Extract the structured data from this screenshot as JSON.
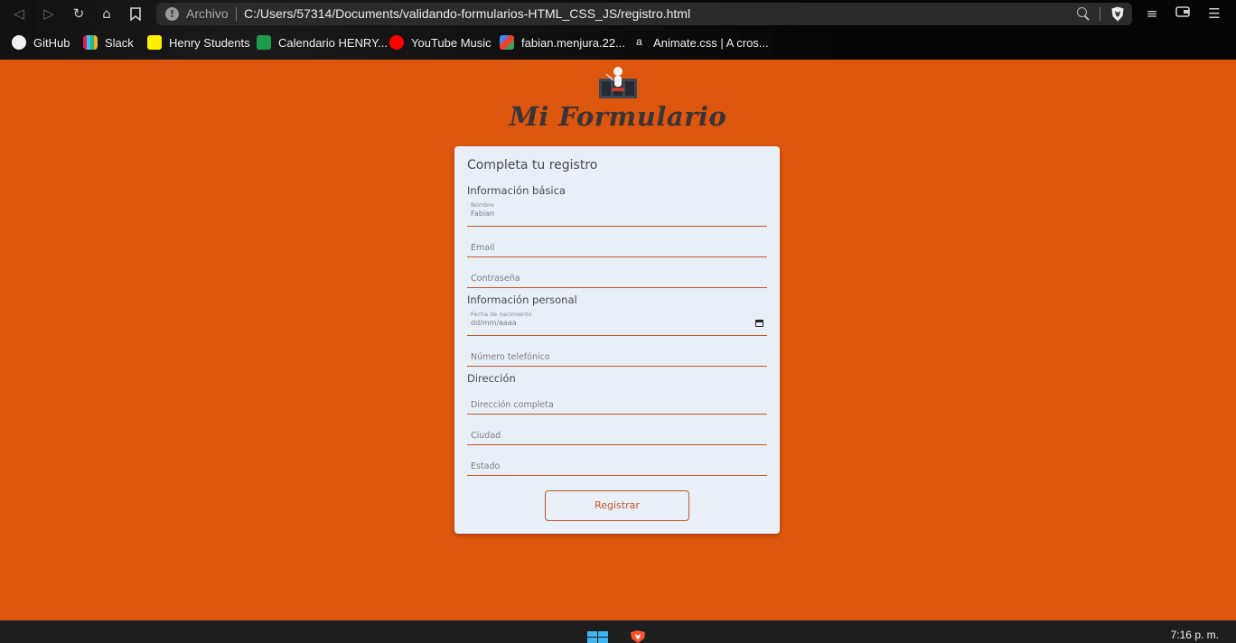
{
  "browser": {
    "url_scheme": "Archivo",
    "url": "C:/Users/57314/Documents/validando-formularios-HTML_CSS_JS/registro.html",
    "bookmarks": [
      {
        "label": "GitHub",
        "icon": "github-icon"
      },
      {
        "label": "Slack",
        "icon": "slack-icon"
      },
      {
        "label": "Henry Students",
        "icon": "henry-icon"
      },
      {
        "label": "Calendario HENRY...",
        "icon": "calendar-icon"
      },
      {
        "label": "YouTube Music",
        "icon": "youtube-music-icon"
      },
      {
        "label": "fabian.menjura.22...",
        "icon": "gmail-icon"
      },
      {
        "label": "Animate.css | A cros...",
        "icon": "animate-icon"
      }
    ],
    "animate_glyph": "a"
  },
  "page": {
    "title": "Mi Formulario",
    "background": "#dc560e"
  },
  "form": {
    "heading": "Completa tu registro",
    "sections": {
      "basic": "Información básica",
      "personal": "Información personal",
      "address": "Dirección"
    },
    "fields": {
      "name": {
        "label": "Nombre",
        "value": "Fabian"
      },
      "email": {
        "placeholder": "Email"
      },
      "password": {
        "placeholder": "Contraseña"
      },
      "birthdate": {
        "label": "Fecha de nacimiento",
        "value": "dd/mm/aaaa"
      },
      "phone": {
        "placeholder": "Número telefónico"
      },
      "address": {
        "placeholder": "Dirección completa"
      },
      "city": {
        "placeholder": "Ciudad"
      },
      "state": {
        "placeholder": "Estado"
      }
    },
    "submit_label": "Registrar"
  },
  "taskbar": {
    "clock": "7:16 p. m."
  }
}
